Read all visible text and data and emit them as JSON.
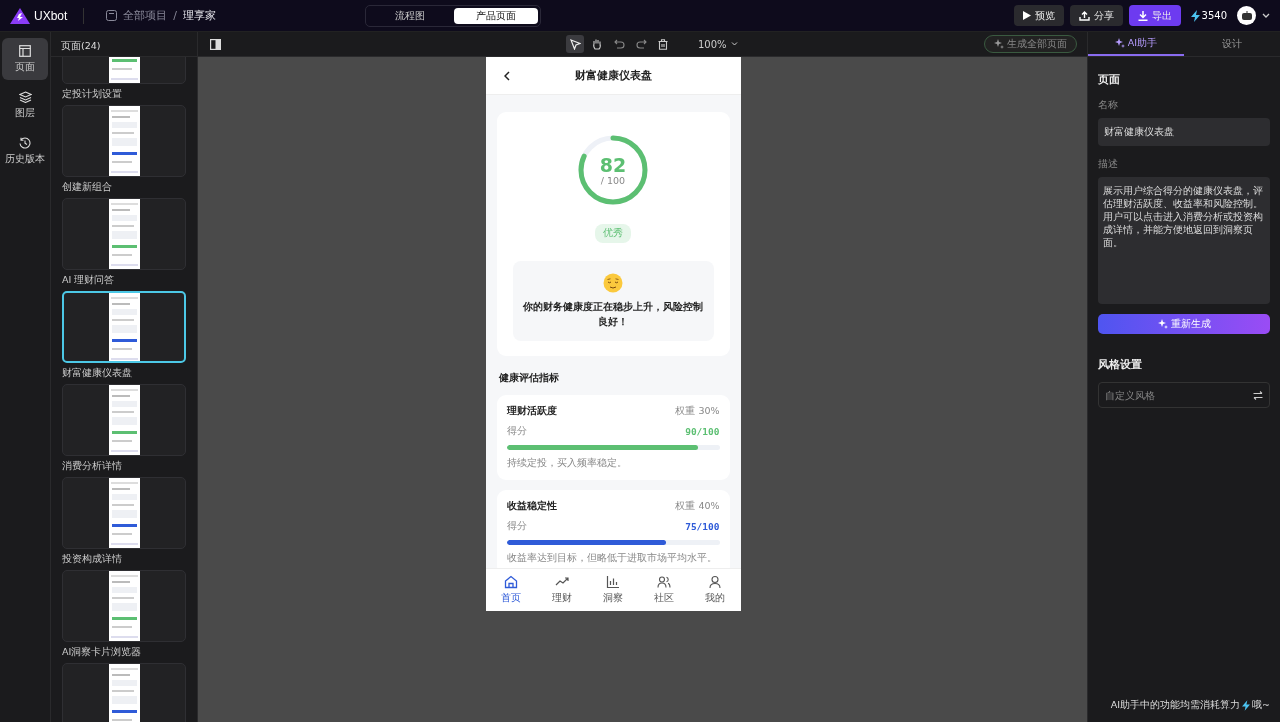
{
  "header": {
    "logo": "UXbot",
    "breadcrumb": [
      "全部项目",
      "/",
      "理享家"
    ],
    "view_tabs": [
      {
        "label": "流程图",
        "selected": false
      },
      {
        "label": "产品页面",
        "selected": true
      }
    ],
    "buttons": [
      {
        "kind": "preview",
        "label": "预览"
      },
      {
        "kind": "share",
        "label": "分享"
      },
      {
        "kind": "export",
        "label": "导出"
      }
    ],
    "credits": "3540"
  },
  "rail": [
    {
      "kind": "pages",
      "label": "页面",
      "selected": true
    },
    {
      "kind": "layers",
      "label": "图层",
      "selected": false
    },
    {
      "kind": "history",
      "label": "历史版本",
      "selected": false
    }
  ],
  "pages_panel": {
    "title": "页面(24)",
    "items": [
      {
        "name": "定投计划设置",
        "selected": false
      },
      {
        "name": "创建新组合",
        "selected": false
      },
      {
        "name": "AI 理财问答",
        "selected": false
      },
      {
        "name": "财富健康仪表盘",
        "selected": true
      },
      {
        "name": "消费分析详情",
        "selected": false
      },
      {
        "name": "投资构成详情",
        "selected": false
      },
      {
        "name": "AI洞察卡片浏览器",
        "selected": false
      },
      {
        "selected": false
      }
    ]
  },
  "toolbar": {
    "tools": [
      {
        "kind": "select",
        "selected": true
      },
      {
        "kind": "hand",
        "selected": false
      },
      {
        "kind": "undo",
        "selected": false
      },
      {
        "kind": "redo",
        "selected": false
      },
      {
        "kind": "delete",
        "selected": false
      }
    ],
    "zoom": "100%",
    "generate_all": "生成全部页面"
  },
  "phone": {
    "title": "财富健康仪表盘",
    "score": "82",
    "score_max": "/ 100",
    "grade": "优秀",
    "message": "你的财务健康度正在稳步上升，风险控制良好！",
    "section_title": "健康评估指标",
    "metrics": [
      {
        "name": "理财活跃度",
        "weight": "权重 30%",
        "score_label": "得分",
        "score": "90/100",
        "level": 0.9,
        "color": "#5cbf72",
        "note": "持续定投，买入频率稳定。"
      },
      {
        "name": "收益稳定性",
        "weight": "权重 40%",
        "score_label": "得分",
        "score": "75/100",
        "level": 0.75,
        "color": "#2f5bd8",
        "note": "收益率达到目标，但略低于进取市场平均水平。"
      }
    ],
    "nav": [
      {
        "kind": "home",
        "label": "首页",
        "selected": true
      },
      {
        "kind": "trend",
        "label": "理财",
        "selected": false
      },
      {
        "kind": "chart",
        "label": "洞察",
        "selected": false
      },
      {
        "kind": "people",
        "label": "社区",
        "selected": false
      },
      {
        "kind": "person",
        "label": "我的",
        "selected": false
      }
    ]
  },
  "right_panel": {
    "tabs": [
      {
        "label": "AI助手",
        "selected": true
      },
      {
        "label": "设计",
        "selected": false
      }
    ],
    "section": "页面",
    "name_label": "名称",
    "name_value": "财富健康仪表盘",
    "desc_label": "描述",
    "desc_value": "展示用户综合得分的健康仪表盘，评估理财活跃度、收益率和风险控制。用户可以点击进入消费分析或投资构成详情，并能方便地返回到洞察页面。",
    "regenerate": "重新生成",
    "style_title": "风格设置",
    "style_placeholder": "自定义风格",
    "footer_before": "AI助手中的功能均需消耗算力",
    "footer_after": "哦~"
  }
}
